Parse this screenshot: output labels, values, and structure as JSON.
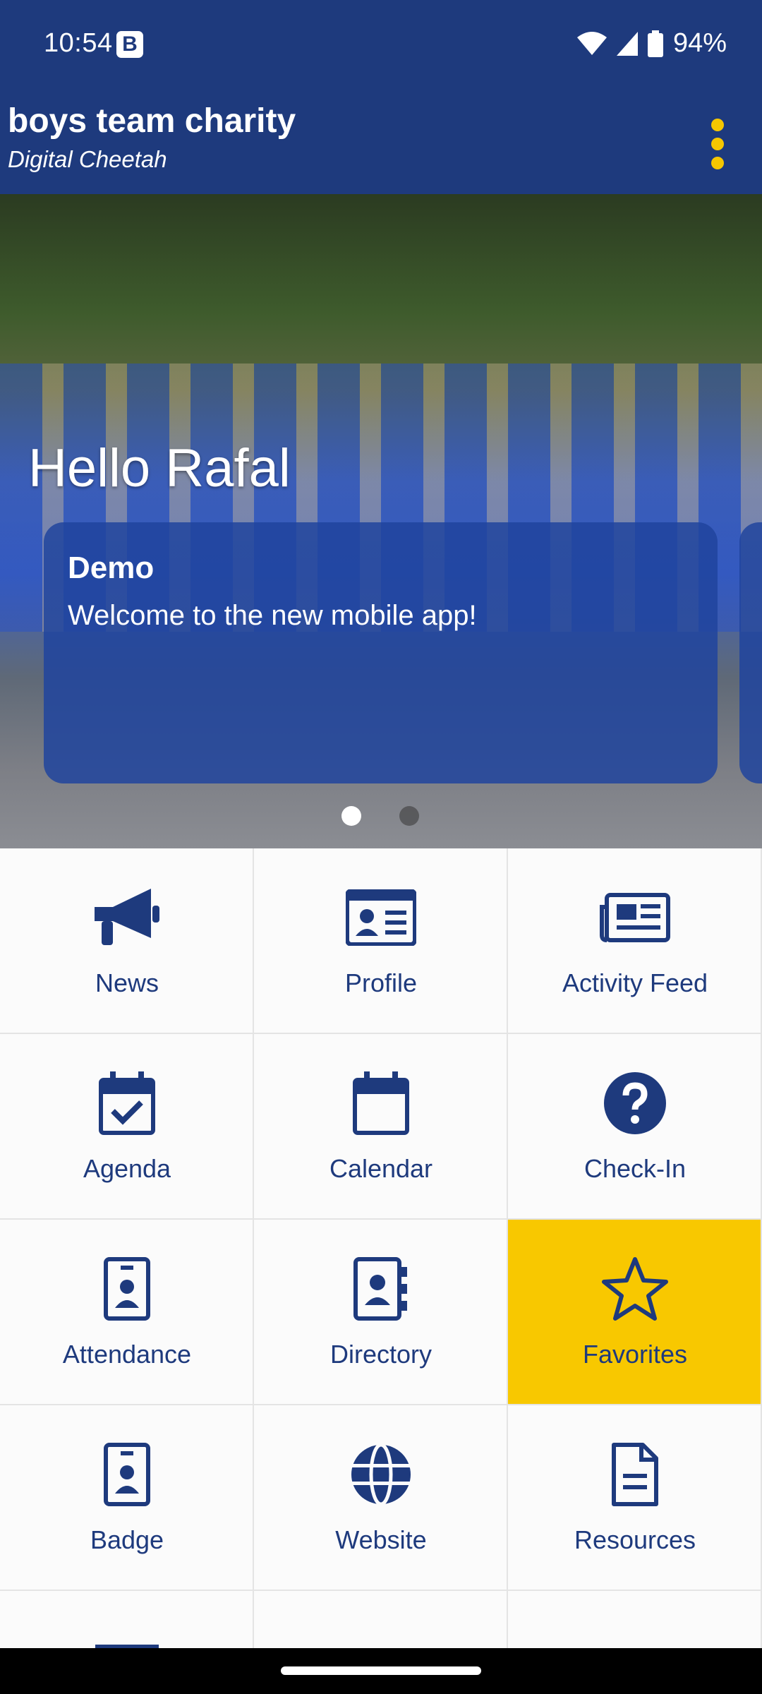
{
  "status_bar": {
    "time": "10:54",
    "notification_badge": "B",
    "battery": "94%"
  },
  "app_bar": {
    "title": "boys team charity",
    "subtitle": "Digital Cheetah",
    "menu_icon": "more-vert-icon",
    "menu_color": "#f6c700"
  },
  "hero": {
    "greeting": "Hello Rafal",
    "announcement": {
      "title": "Demo",
      "text": "Welcome to the new mobile app!"
    }
  },
  "grid": {
    "tiles": [
      {
        "label": "News",
        "icon": "megaphone-icon"
      },
      {
        "label": "Profile",
        "icon": "id-card-icon"
      },
      {
        "label": "Activity Feed",
        "icon": "newspaper-icon"
      },
      {
        "label": "Agenda",
        "icon": "calendar-check-icon"
      },
      {
        "label": "Calendar",
        "icon": "calendar-icon"
      },
      {
        "label": "Check-In",
        "icon": "question-circle-icon"
      },
      {
        "label": "Attendance",
        "icon": "person-badge-icon"
      },
      {
        "label": "Directory",
        "icon": "address-book-icon"
      },
      {
        "label": "Favorites",
        "icon": "star-icon",
        "highlight": true
      },
      {
        "label": "Badge",
        "icon": "person-badge-icon"
      },
      {
        "label": "Website",
        "icon": "globe-icon"
      },
      {
        "label": "Resources",
        "icon": "document-icon"
      }
    ]
  },
  "colors": {
    "brand": "#1e3a7d",
    "accent": "#f8c800",
    "tile_background": "#fbfbfb"
  }
}
